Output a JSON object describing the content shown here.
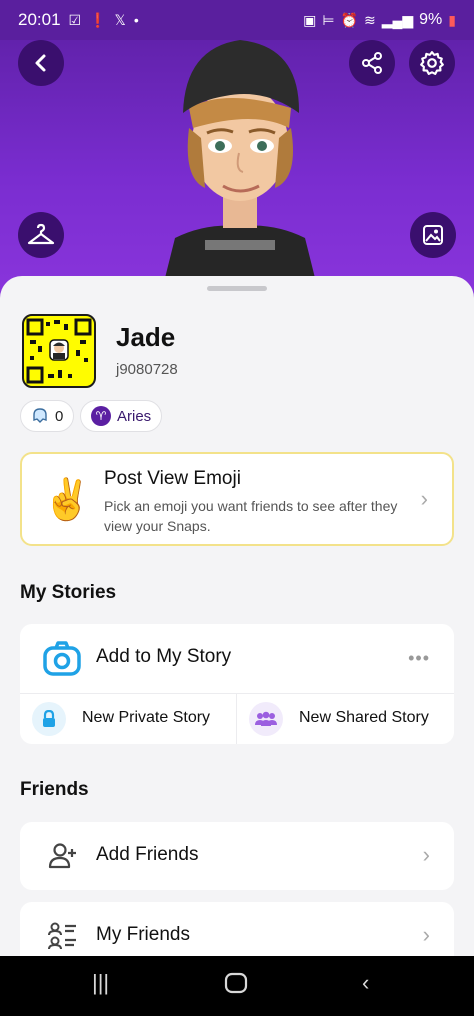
{
  "status_bar": {
    "time": "20:01",
    "battery": "9%"
  },
  "profile": {
    "display_name": "Jade",
    "username": "j9080728",
    "friend_count": "0",
    "zodiac": "Aries"
  },
  "emoji_card": {
    "title": "Post View Emoji",
    "subtitle": "Pick an emoji you want friends to see after they view your Snaps.",
    "emoji": "✌️"
  },
  "stories": {
    "section_title": "My Stories",
    "add_story": "Add to My Story",
    "new_private": "New Private Story",
    "new_shared": "New Shared Story"
  },
  "friends": {
    "section_title": "Friends",
    "add_friends": "Add Friends",
    "my_friends": "My Friends"
  },
  "colors": {
    "header_purple": "#6b28c0",
    "snap_yellow": "#fffc00",
    "accent_blue": "#1fa2e6"
  },
  "icons": [
    "back-icon",
    "share-icon",
    "settings-icon",
    "hanger-icon",
    "gallery-icon",
    "camera-icon",
    "lock-icon",
    "group-icon",
    "add-friend-icon",
    "friends-list-icon"
  ]
}
